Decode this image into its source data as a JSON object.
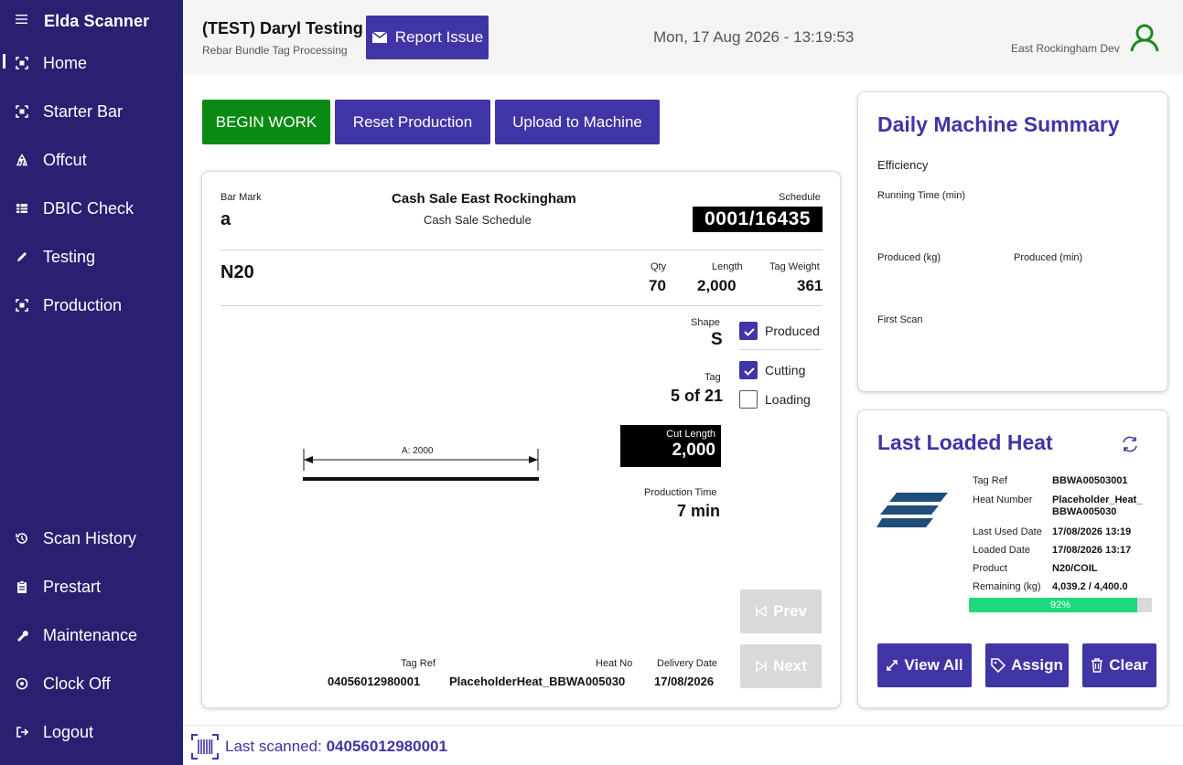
{
  "sidebar": {
    "title": "Elda Scanner",
    "items": [
      {
        "label": "Home",
        "icon": "scan-icon"
      },
      {
        "label": "Starter Bar",
        "icon": "scan-icon"
      },
      {
        "label": "Offcut",
        "icon": "recycle-icon"
      },
      {
        "label": "DBIC Check",
        "icon": "table-icon"
      },
      {
        "label": "Testing",
        "icon": "pencil-icon"
      },
      {
        "label": "Production",
        "icon": "scan-icon"
      }
    ],
    "bottom_items": [
      {
        "label": "Scan History",
        "icon": "history-icon"
      },
      {
        "label": "Prestart",
        "icon": "clipboard-icon"
      },
      {
        "label": "Maintenance",
        "icon": "wrench-icon"
      },
      {
        "label": "Clock Off",
        "icon": "clock-off-icon"
      },
      {
        "label": "Logout",
        "icon": "logout-icon"
      }
    ]
  },
  "header": {
    "user_name": "(TEST) Daryl Testing",
    "subtitle": "Rebar Bundle Tag Processing",
    "report_label": "Report Issue",
    "datetime": "Mon, 17 Aug 2026 - 13:19:53",
    "site": "East Rockingham Dev"
  },
  "actions": {
    "begin": "BEGIN WORK",
    "reset": "Reset Production",
    "upload": "Upload to Machine"
  },
  "tag": {
    "bar_mark_label": "Bar Mark",
    "bar_mark": "a",
    "customer": "Cash Sale East Rockingham",
    "schedule_name": "Cash Sale Schedule",
    "schedule_label": "Schedule",
    "schedule": "0001/16435",
    "product": "N20",
    "qty_label": "Qty",
    "qty": "70",
    "length_label": "Length",
    "length": "2,000",
    "weight_label": "Tag Weight",
    "weight": "361",
    "shape_label": "Shape",
    "shape": "S",
    "tag_label": "Tag",
    "tag_pos": "5 of 21",
    "cut_length_label": "Cut Length",
    "cut_length": "2,000",
    "prod_time_label": "Production Time",
    "prod_time": "7 min",
    "dim_label": "A: 2000",
    "checks": {
      "produced": "Produced",
      "cutting": "Cutting",
      "loading": "Loading"
    },
    "prev": "Prev",
    "next": "Next",
    "tag_ref_label": "Tag Ref",
    "tag_ref": "04056012980001",
    "heat_no_label": "Heat No",
    "heat_no": "PlaceholderHeat_BBWA005030",
    "delivery_label": "Delivery Date",
    "delivery": "17/08/2026"
  },
  "summary": {
    "title": "Daily Machine Summary",
    "efficiency": "Efficiency",
    "running_time": "Running Time (min)",
    "produced_kg": "Produced (kg)",
    "produced_min": "Produced (min)",
    "first_scan": "First Scan"
  },
  "heat": {
    "title": "Last Loaded Heat",
    "rows": [
      {
        "label": "Tag Ref",
        "value": "BBWA00503001"
      },
      {
        "label": "Heat Number",
        "value": "Placeholder_Heat_\nBBWA005030"
      },
      {
        "label": "Last Used Date",
        "value": "17/08/2026 13:19"
      },
      {
        "label": "Loaded Date",
        "value": "17/08/2026 13:17"
      },
      {
        "label": "Product",
        "value": "N20/COIL"
      },
      {
        "label": "Remaining (kg)",
        "value": "4,039.2 / 4,400.0"
      }
    ],
    "progress": 92,
    "progress_label": "92%",
    "view_all": "View All",
    "assign": "Assign",
    "clear": "Clear"
  },
  "footer": {
    "label": "Last scanned:",
    "value": "04056012980001"
  },
  "colors": {
    "sidebar": "#282172",
    "accent": "#3f35a6",
    "begin": "#0a8a12",
    "progress": "#1fd87e",
    "user_icon": "#1a8a1f"
  }
}
